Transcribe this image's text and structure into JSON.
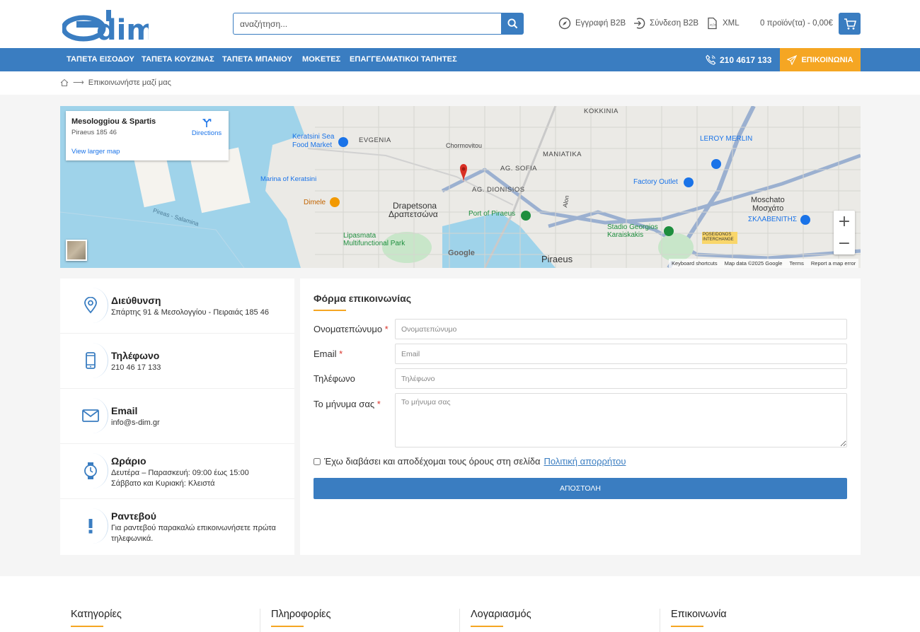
{
  "search": {
    "placeholder": "αναζήτηση..."
  },
  "header_links": {
    "register": "Εγγραφή B2B",
    "login": "Σύνδεση B2B",
    "xml": "XML",
    "cart": "0 προϊόν(τα) - 0,00€"
  },
  "nav": {
    "items": [
      "ΤΑΠΕΤΑ ΕΙΣΟΔΟΥ",
      "ΤΑΠΕΤΑ ΚΟΥΖΙΝΑΣ",
      "ΤΑΠΕΤΑ ΜΠΑΝΙΟΥ",
      "ΜΟΚΕΤΕΣ",
      "ΕΠΑΓΓΕΛΜΑΤΙΚΟΙ ΤΑΠΗΤΕΣ"
    ],
    "phone": "210 4617 133",
    "contact": "ΕΠΙΚΟΙΝΩΝΙΑ"
  },
  "breadcrumb": {
    "current": "Επικοινωνήστε μαζί μας"
  },
  "map": {
    "card_title": "Mesologgiou & Spartis",
    "card_address": "Piraeus 185 46",
    "card_link": "View larger map",
    "directions": "Directions",
    "labels": {
      "keratsini_market": "Keratsini Sea Food Market",
      "evgenia": "EVGENIA",
      "drapetsona": "Drapetsona",
      "drapetsona_gr": "Δραπετσώνα",
      "marina": "Marina of Keratsini",
      "dimele": "Dimele",
      "port": "Port of Piraeus",
      "lipasmata": "Lipasmata Multifunctional Park",
      "piraeus": "Piraeus",
      "ag_dionisios": "AG. DIONISIOS",
      "ag_sofia": "AG. SOFIA",
      "maniatika": "MANIATIKA",
      "kokkinia": "KOKKINIA",
      "leroy": "LEROY MERLIN",
      "factory": "Factory Outlet",
      "stadio": "Stadio Georgios Karaiskakis",
      "moschato": "Moschato",
      "moschato_gr": "Μοσχάτο",
      "sklavenitis": "ΣΚΛΑΒΕΝΙΤΗΣ",
      "poseidonos": "POSEIDONOS INTERCHANGE",
      "chormovitou": "Chormovitou",
      "alon": "Alon",
      "piraeus_salamina": "Pireas - Salamina"
    },
    "google": "Google",
    "footer": [
      "Keyboard shortcuts",
      "Map data ©2025 Google",
      "Terms",
      "Report a map error"
    ]
  },
  "info": [
    {
      "icon": "location-pin-icon",
      "title": "Διεύθυνση",
      "lines": [
        "Σπάρτης 91 & Μεσολογγίου - Πειραιάς 185 46"
      ]
    },
    {
      "icon": "phone-icon",
      "title": "Τηλέφωνο",
      "lines": [
        "210 46 17 133"
      ]
    },
    {
      "icon": "email-icon",
      "title": "Email",
      "lines": [
        "info@s-dim.gr"
      ]
    },
    {
      "icon": "clock-icon",
      "title": "Ωράριο",
      "lines": [
        "Δευτέρα – Παρασκευή: 09:00 έως 15:00",
        "Σάββατο και Κυριακή: Κλειστά"
      ]
    },
    {
      "icon": "exclamation-icon",
      "title": "Ραντεβού",
      "lines": [
        "Για ραντεβού παρακαλώ επικοινωνήσετε πρώτα τηλεφωνικά."
      ]
    }
  ],
  "form": {
    "title": "Φόρμα επικοινωνίας",
    "name_label": "Ονοματεπώνυμο",
    "name_placeholder": "Ονοματεπώνυμο",
    "email_label": "Email",
    "email_placeholder": "Email",
    "phone_label": "Τηλέφωνο",
    "phone_placeholder": "Τηλέφωνο",
    "message_label": "Το μήνυμα σας",
    "message_placeholder": "Το μήνυμα σας",
    "required_mark": "*",
    "consent_text": "Έχω διαβάσει και αποδέχομαι τους όρους στη σελίδα",
    "privacy_link": "Πολιτική απορρήτου",
    "submit": "ΑΠΟΣΤΟΛΗ"
  },
  "footer": {
    "columns": [
      "Κατηγορίες",
      "Πληροφορίες",
      "Λογαριασμός",
      "Επικοινωνία"
    ]
  },
  "colors": {
    "primary": "#3a7dc1",
    "accent": "#f5a623"
  }
}
